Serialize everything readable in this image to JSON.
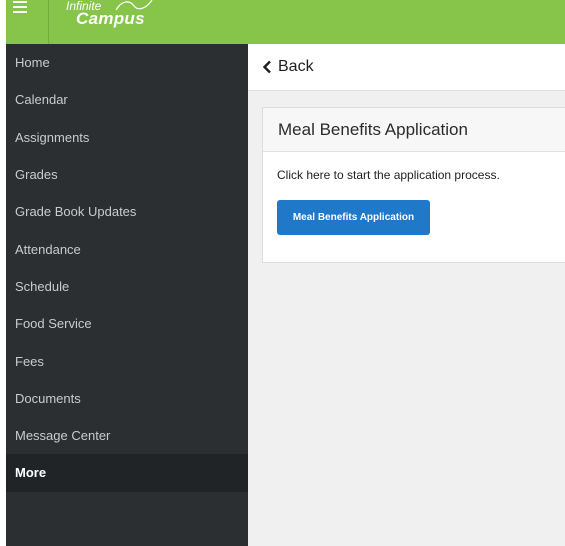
{
  "header": {
    "menu_icon": "hamburger-menu-icon",
    "brand_color": "#86c44a",
    "logo_top": "Infinite",
    "logo_main": "Campus"
  },
  "sidebar": {
    "background": "#2b2f31",
    "items": [
      {
        "label": "Home",
        "active": false
      },
      {
        "label": "Calendar",
        "active": false
      },
      {
        "label": "Assignments",
        "active": false
      },
      {
        "label": "Grades",
        "active": false
      },
      {
        "label": "Grade Book Updates",
        "active": false
      },
      {
        "label": "Attendance",
        "active": false
      },
      {
        "label": "Schedule",
        "active": false
      },
      {
        "label": "Food Service",
        "active": false
      },
      {
        "label": "Fees",
        "active": false
      },
      {
        "label": "Documents",
        "active": false
      },
      {
        "label": "Message Center",
        "active": false
      },
      {
        "label": "More",
        "active": true
      }
    ]
  },
  "main": {
    "back_icon": "chevron-left-icon",
    "back_label": "Back",
    "card": {
      "title": "Meal Benefits Application",
      "description": "Click here to start the application process.",
      "button_label": "Meal Benefits Application",
      "button_color": "#1f78c8"
    }
  }
}
